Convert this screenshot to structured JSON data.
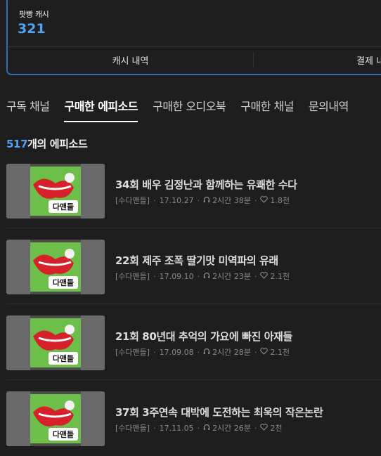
{
  "cash": {
    "label": "팟빵 캐시",
    "amount": "321",
    "history_label": "캐시 내역",
    "pay_label": "결제 내"
  },
  "tabs": [
    {
      "label": "구독 채널",
      "active": false
    },
    {
      "label": "구매한 에피소드",
      "active": true
    },
    {
      "label": "구매한 오디오북",
      "active": false
    },
    {
      "label": "구매한 채널",
      "active": false
    },
    {
      "label": "문의내역",
      "active": false
    }
  ],
  "episode_count": {
    "number": "517",
    "suffix": "개의 에피소드"
  },
  "episodes": [
    {
      "title": "34회 배우 김정난과 함께하는 유쾌한 수다",
      "channel": "[수다맨들]",
      "date": "17.10.27",
      "duration": "2시간 38분",
      "likes": "1.8천"
    },
    {
      "title": "22회 제주 조폭 딸기맛 미역파의 유래",
      "channel": "[수다맨들]",
      "date": "17.09.10",
      "duration": "2시간 23분",
      "likes": "2.1천"
    },
    {
      "title": "21회 80년대 추억의 가요에 빠진 아재들",
      "channel": "[수다맨들]",
      "date": "17.09.08",
      "duration": "2시간 28분",
      "likes": "2.1천"
    },
    {
      "title": "37회 3주연속 대박에 도전하는 최욱의 작은논란",
      "channel": "[수다맨들]",
      "date": "17.11.05",
      "duration": "2시간 26분",
      "likes": "2천"
    }
  ],
  "thumbnail_text": "다맨들",
  "colors": {
    "accent": "#4ea3f5",
    "border": "#2f6fb0",
    "background": "#1e1e1e",
    "thumb_green": "#6cc04a",
    "thumb_red": "#d6202a"
  },
  "icons": {
    "duration": "headphones-icon",
    "likes": "heart-icon"
  }
}
